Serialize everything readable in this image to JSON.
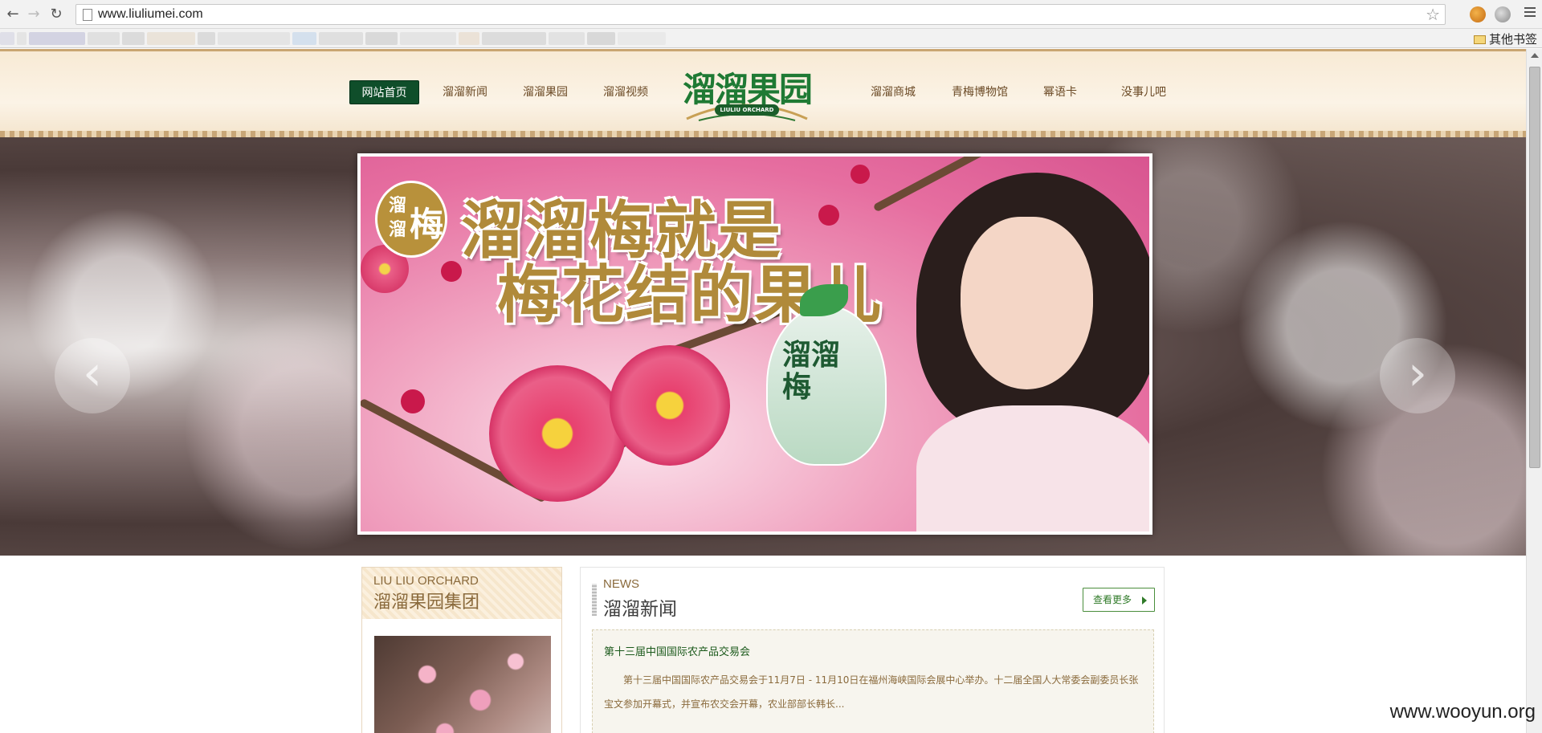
{
  "browser": {
    "url": "www.liuliumei.com",
    "other_bookmarks": "其他书签",
    "bookmark_strip_colors": [
      "#cfcfe0",
      "#d8d8d8",
      "#b9b9d6",
      "#d2d2d2",
      "#c8c8c8",
      "#e3d7c4",
      "#c9c9c9",
      "#d8d8d8",
      "#bcd2ea",
      "#cfcfcf",
      "#c4c4c4",
      "#d9d9d9",
      "#e6d5c1",
      "#cacaca",
      "#d5d5d5",
      "#c2c2c2",
      "#e2e2e2"
    ]
  },
  "nav": {
    "items": [
      "网站首页",
      "溜溜新闻",
      "溜溜果园",
      "溜溜视频",
      "溜溜商城",
      "青梅博物馆",
      "幂语卡",
      "没事儿吧"
    ],
    "active_index": 0
  },
  "logo": {
    "text": "溜溜果园",
    "subtitle": "LIULIU ORCHARD"
  },
  "banner": {
    "prev_icon": "‹",
    "next_icon": "›",
    "badge": [
      "溜",
      "溜",
      "梅"
    ],
    "headline_1": "溜溜梅就是",
    "headline_2": "梅花结的果儿",
    "product_text": "溜溜梅"
  },
  "side": {
    "en": "LIU LIU ORCHARD",
    "cn": "溜溜果园集团"
  },
  "news": {
    "en": "NEWS",
    "cn": "溜溜新闻",
    "more": "查看更多",
    "item_title": "第十三届中国国际农产品交易会",
    "item_body": "第十三届中国国际农产品交易会于11月7日 - 11月10日在福州海峡国际会展中心举办。十二届全国人大常委会副委员长张宝文参加开幕式，并宣布农交会开幕，农业部部长韩长..."
  },
  "watermark": "www.wooyun.org",
  "colors": {
    "nav_active_bg": "#0f4e2a",
    "brand_green": "#1f7a34",
    "gold": "#b08a3a"
  }
}
